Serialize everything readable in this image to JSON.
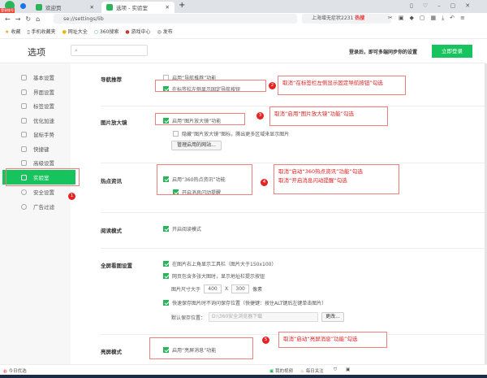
{
  "browser": {
    "login_badge": "登录账号",
    "tabs": [
      {
        "label": "欢迎页"
      },
      {
        "label": "选项 - 实验室"
      }
    ],
    "url": "se://settings/lib",
    "search_text": "上海增无症状2231",
    "hot_label": "热搜",
    "bookmarks": [
      "收藏",
      "手机收藏夹",
      "网址大全",
      "360搜索",
      "游戏中心",
      "发布"
    ]
  },
  "header": {
    "title": "选项",
    "search_placeholder": "",
    "login_hint": "登录后，即可多端同步你的设置",
    "login_button": "立即登录"
  },
  "sidebar": {
    "items": [
      {
        "label": "基本设置"
      },
      {
        "label": "界面设置"
      },
      {
        "label": "标签设置"
      },
      {
        "label": "优化加速"
      },
      {
        "label": "鼠标手势"
      },
      {
        "label": "快捷键"
      },
      {
        "label": "高级设置"
      },
      {
        "label": "实验室",
        "active": true
      },
      {
        "label": "安全设置"
      },
      {
        "label": "广告过滤"
      }
    ]
  },
  "sections": {
    "nav": {
      "label": "导航推荐",
      "opt1": "启用“导航推荐”功能",
      "opt2": "在标签栏左侧显示固定导航按钮"
    },
    "magnifier": {
      "label": "图片放大镜",
      "opt1": "启用“图片放大镜”功能",
      "opt2": "隐藏“图片放大镜”图标，腾出更多区域来显示图片",
      "manage_button": "管理启用的网站..."
    },
    "hot": {
      "label": "热点资讯",
      "opt1": "启用“360热点资讯”功能",
      "opt2": "开启消息闪动提醒"
    },
    "reading": {
      "label": "阅读模式",
      "opt1": "开启阅读模式"
    },
    "fullscreen": {
      "label": "全屏看图设置",
      "opt1": "在图片右上角显示工具栏（图片大于150x100）",
      "opt2": "网页包含多张大图时，显示地址栏提示按钮",
      "size_prefix": "图片尺寸大于",
      "width": "400",
      "x": "X",
      "height": "300",
      "size_suffix": "像素",
      "opt3": "快速保存图片时不询问保存位置（快捷键：按住ALT键后左键单击图片）",
      "save_label": "默认保存位置：",
      "save_path": "D:\\360安全浏览器下载",
      "change_button": "更改..."
    },
    "bright": {
      "label": "亮屏模式",
      "opt1": "启用“亮屏消息”功能"
    }
  },
  "annotations": [
    {
      "num": "1"
    },
    {
      "num": "2",
      "text": "取消“在标签栏左侧显示固定导航按钮”勾选"
    },
    {
      "num": "3",
      "text": "取消“启用“图片放大镜”功能”勾选"
    },
    {
      "num": "4",
      "text": "取消“启动“360热点资讯”功能”勾选",
      "text2": "取消“开启消息闪动提醒”勾选"
    },
    {
      "num": "5",
      "text": "取消“启动“亮屏消息”功能”勾选"
    }
  ],
  "status": {
    "left": "今日优选",
    "video": "我的视频",
    "follow": "每日关注"
  },
  "colors": {
    "accent": "#17c35d",
    "annotation": "#e02020"
  }
}
